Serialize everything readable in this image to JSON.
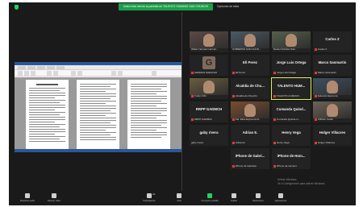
{
  "share_banner": "Usted está viendo la pantalla de TALENTO HUMANO GAD CHUNCHI",
  "view_options": "Opciones de vista",
  "participants": [
    {
      "name": "",
      "label": "Walter Narvaez Hernan...",
      "video": true,
      "bg": "#5b4a44"
    },
    {
      "name": "",
      "label": "GOBIERNO GAD CHUN...",
      "video": true,
      "bg": "#4a5a66"
    },
    {
      "name": "",
      "label": "Daniel Ordóñez Zati...",
      "video": true,
      "bg": "#54604c"
    },
    {
      "name": "Carlos Z",
      "label": "Carlos Z",
      "video": false,
      "muted": true
    },
    {
      "name": "",
      "label": "GERMAN NARANJO",
      "video": false,
      "avatar": "G",
      "muted": true
    },
    {
      "name": "Eli Perez",
      "label": "Eli Perez",
      "video": false,
      "muted": true
    },
    {
      "name": "Jorge Luis Ortega",
      "label": "Jorge Luis Ortega",
      "video": false,
      "muted": true
    },
    {
      "name": "Marco Sanmartin",
      "label": "Marco Sanmartin",
      "video": false,
      "muted": true
    },
    {
      "name": "",
      "label": "Fredy Ortiz",
      "video": true,
      "bg": "#6a5e3e",
      "muted": true
    },
    {
      "name": "Alcaldia de Chu...",
      "label": "Alcaldia de Chunchi",
      "video": false,
      "muted": true
    },
    {
      "name": "TALENTO HUM...",
      "label": "TALENTO HUMANO...",
      "video": false,
      "talking": true,
      "muted": true
    },
    {
      "name": "",
      "label": "Eduardo Espinoza",
      "video": true,
      "bg": "#3e5060",
      "muted": true
    },
    {
      "name": "RRPP GADMCH",
      "label": "RRPP GADMCH",
      "video": false,
      "muted": true
    },
    {
      "name": "",
      "label": "Ma. Elisa Espinoza M...",
      "video": true,
      "bg": "#7a4d2c",
      "muted": true
    },
    {
      "name": "Cumanda Quind...",
      "label": "Cumanda Quinde G...",
      "video": false,
      "muted": true
    },
    {
      "name": "",
      "label": "Wilfrido Coello",
      "video": true,
      "bg": "#6a6458",
      "muted": true
    },
    {
      "name": "gaby rivera",
      "label": "gaby rivera",
      "video": false
    },
    {
      "name": "Adrian E.",
      "label": "Adrian E.",
      "video": false,
      "muted": true
    },
    {
      "name": "Henry Vega",
      "label": "Henry Vega",
      "video": false,
      "muted": true
    },
    {
      "name": "Holger Villacres",
      "label": "Holger Villacres",
      "video": false,
      "muted": true
    },
    {
      "name": "iPhone de Gabri...",
      "label": "iPhone de Gabriela",
      "video": false,
      "muted": true
    },
    {
      "name": "iPhone de Hom...",
      "label": "iPhone de Homero",
      "video": false,
      "muted": true
    }
  ],
  "toolbar": [
    {
      "icon": "microphone-icon",
      "label": "Reactivar audio",
      "color": "#cfcfcf"
    },
    {
      "icon": "video-camera-icon",
      "label": "Detener video",
      "color": "#cfcfcf"
    },
    {
      "icon": "participants-icon",
      "label": "Participantes",
      "color": "#cfcfcf",
      "count": "22"
    },
    {
      "icon": "chat-icon",
      "label": "Chat",
      "color": "#cfcfcf"
    },
    {
      "icon": "share-screen-icon",
      "label": "Compartir pantalla",
      "color": "#23d160"
    },
    {
      "icon": "record-icon",
      "label": "Grabar",
      "color": "#cfcfcf"
    },
    {
      "icon": "reactions-icon",
      "label": "Reacciones",
      "color": "#cfcfcf"
    },
    {
      "icon": "apps-icon",
      "label": "Aplicaciones",
      "color": "#cfcfcf"
    }
  ],
  "activate_windows": {
    "title": "Activar Windows",
    "subtitle": "Ve a Configuración para activar Windows."
  },
  "colors": {
    "background": "#1a1a1a",
    "tile": "#232323",
    "accent_green": "#23d160",
    "muted_red": "#e0393e",
    "talking_outline": "#e0f050"
  }
}
